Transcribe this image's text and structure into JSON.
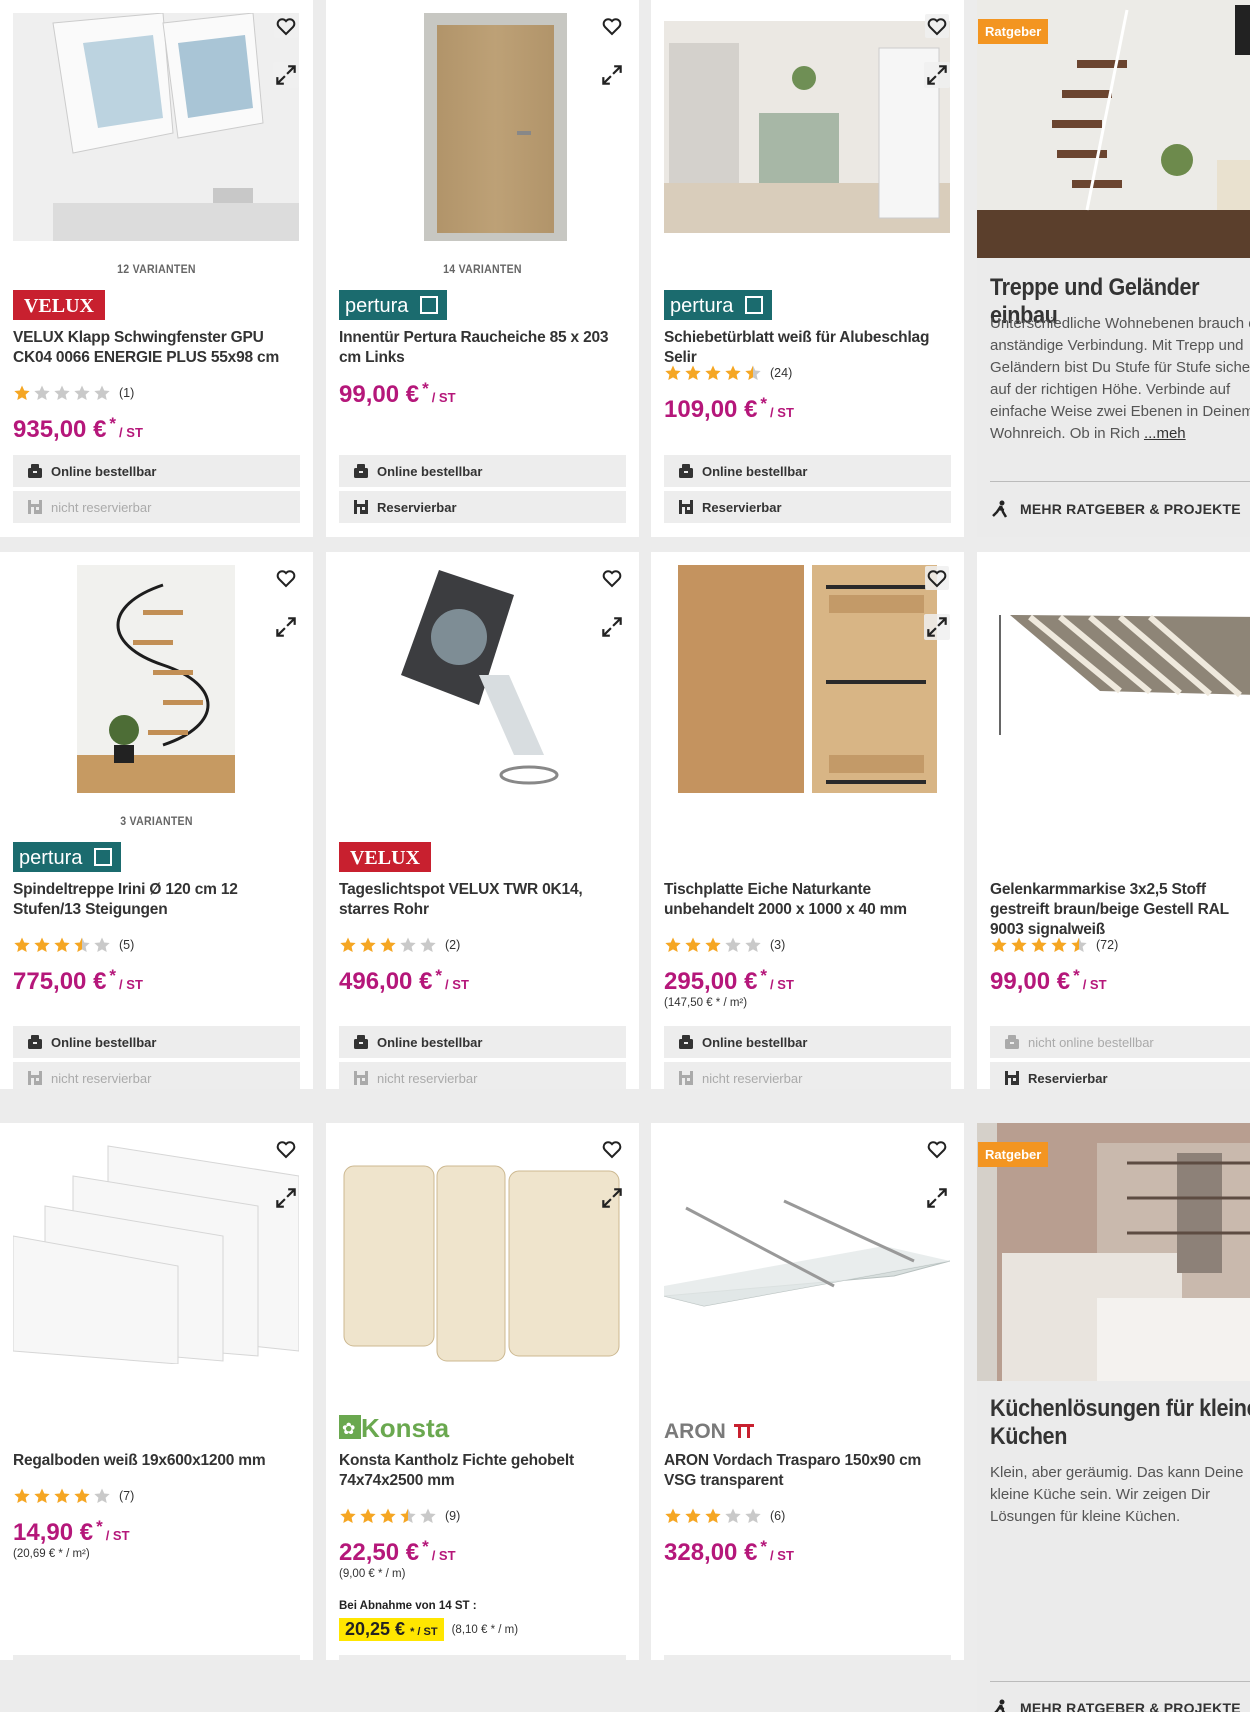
{
  "colors": {
    "price": "#b5177a",
    "star": "#f5a623",
    "badge": "#f39521",
    "velux": "#c8202f",
    "pertura": "#1b6b6e",
    "konsta": "#6aa84f"
  },
  "labels": {
    "online": "Online bestellbar",
    "not_online": "nicht online bestellbar",
    "reserve": "Reservierbar",
    "not_reserve": "nicht reservierbar",
    "more_guides": "MEHR RATGEBER & PROJEKTE",
    "badge": "Ratgeber"
  },
  "products": [
    {
      "variants": "12 VARIANTEN",
      "brand": "VELUX",
      "title": "VELUX Klapp Schwingfenster GPU CK04 0066 ENERGIE PLUS 55x98 cm",
      "rating": 1,
      "reviews": "(1)",
      "price": "935,00 €",
      "ast": "*",
      "unit": "/ ST",
      "online": true,
      "reserve": false
    },
    {
      "variants": "14 VARIANTEN",
      "brand": "pertura",
      "title": "Innentür Pertura Raucheiche 85 x 203 cm Links",
      "rating": 0,
      "reviews": "",
      "price": "99,00 €",
      "ast": "*",
      "unit": "/ ST",
      "online": true,
      "reserve": true
    },
    {
      "variants": "",
      "brand": "pertura",
      "title": "Schiebetürblatt weiß für Alubeschlag Selir",
      "rating": 4.5,
      "reviews": "(24)",
      "price": "109,00 €",
      "ast": "*",
      "unit": "/ ST",
      "online": true,
      "reserve": true
    },
    {
      "variants": "3 VARIANTEN",
      "brand": "pertura",
      "title": "Spindeltreppe Irini Ø 120 cm 12 Stufen/13 Steigungen",
      "rating": 3.5,
      "reviews": "(5)",
      "price": "775,00 €",
      "ast": "*",
      "unit": "/ ST",
      "online": true,
      "reserve": false
    },
    {
      "variants": "",
      "brand": "VELUX",
      "title": "Tageslichtspot VELUX TWR 0K14, starres Rohr",
      "rating": 3,
      "reviews": "(2)",
      "price": "496,00 €",
      "ast": "*",
      "unit": "/ ST",
      "online": true,
      "reserve": false
    },
    {
      "variants": "",
      "brand": "",
      "title": "Tischplatte Eiche Naturkante unbehandelt 2000 x 1000 x 40 mm",
      "rating": 3,
      "reviews": "(3)",
      "price": "295,00 €",
      "ast": "*",
      "unit": "/ ST",
      "unit_price": "(147,50 € * / m²)",
      "online": true,
      "reserve": false
    },
    {
      "variants": "",
      "brand": "",
      "title": "Gelenkarmmarkise 3x2,5 Stoff gestreift braun/beige Gestell RAL 9003 signalweiß",
      "rating": 4.5,
      "reviews": "(72)",
      "price": "99,00 €",
      "ast": "*",
      "unit": "/ ST",
      "online": false,
      "reserve": true
    },
    {
      "variants": "",
      "brand": "",
      "title": "Regalboden weiß 19x600x1200 mm",
      "rating": 4,
      "reviews": "(7)",
      "price": "14,90 €",
      "ast": "*",
      "unit": "/ ST",
      "unit_price": "(20,69 € * / m²)",
      "online": true,
      "reserve": true
    },
    {
      "variants": "",
      "brand": "Konsta",
      "title": "Konsta Kantholz Fichte gehobelt 74x74x2500 mm",
      "rating": 3.5,
      "reviews": "(9)",
      "price": "22,50 €",
      "ast": "*",
      "unit": "/ ST",
      "unit_price": "(9,00 € * / m)",
      "bulk_label": "Bei Abnahme von 14 ST :",
      "bulk_price": "20,25 €",
      "bulk_unit": "* / ST",
      "bulk_unit_price": "(8,10 € * / m)",
      "online": true,
      "reserve": true
    },
    {
      "variants": "",
      "brand": "ARON",
      "title": "ARON Vordach Trasparo 150x90 cm VSG transparent",
      "rating": 3,
      "reviews": "(6)",
      "price": "328,00 €",
      "ast": "*",
      "unit": "/ ST",
      "online": true,
      "reserve": false
    }
  ],
  "guides": [
    {
      "title": "Treppe und Geländer einbau",
      "text": "Unterschiedliche Wohnebenen brauch eine anständige Verbindung. Mit Trepp und Geländern bist Du Stufe für Stufe sicher auf der richtigen Höhe. Verbinde auf einfache Weise zwei Ebenen in Deinem Wohnreich. Ob in Rich",
      "more_link": "...meh"
    },
    {
      "title": "Küchenlösungen für kleine Küchen",
      "text": "Klein, aber geräumig. Das kann Deine kleine Küche sein. Wir zeigen Dir Lösungen für kleine Küchen."
    }
  ]
}
